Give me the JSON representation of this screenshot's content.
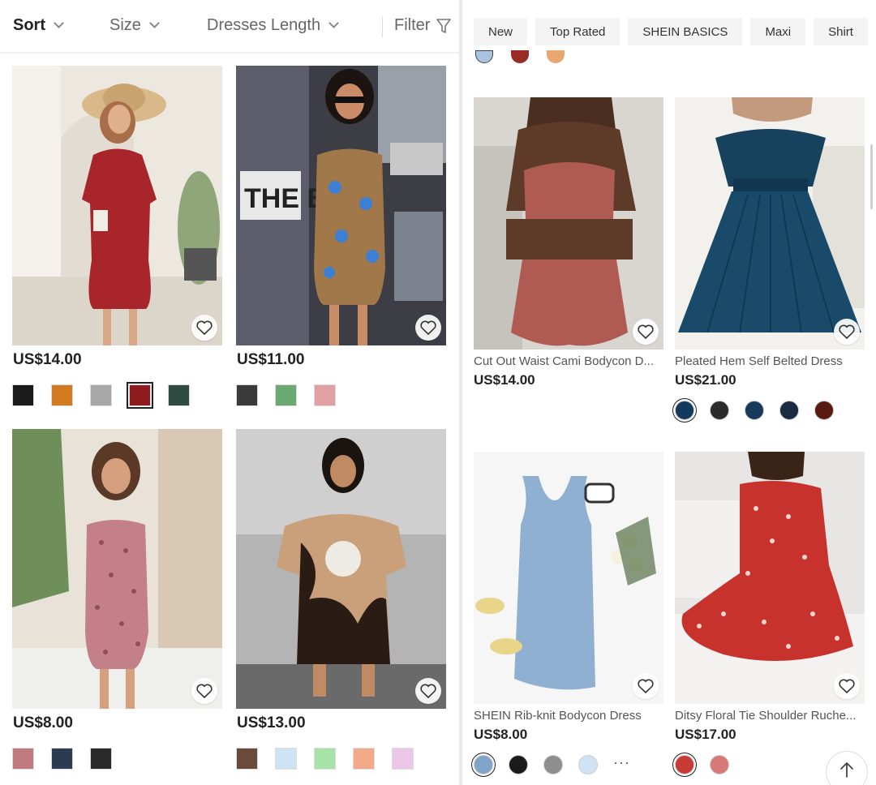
{
  "left": {
    "toolbar": {
      "sort": "Sort",
      "size": "Size",
      "length": "Dresses Length",
      "filter": "Filter"
    },
    "products": [
      {
        "price": "US$14.00",
        "swatches": [
          "#1a1a1a",
          "#d17a22",
          "#a8a8a8",
          "#8e1c1f",
          "#2f4a40"
        ],
        "selected": 3
      },
      {
        "price": "US$11.00",
        "swatches": [
          "#3a3a3a",
          "#6aaa72",
          "#e3a0a4"
        ],
        "selected": -1
      },
      {
        "price": "US$8.00",
        "swatches": [
          "#c07a80",
          "#2c3a52",
          "#2a2a2a"
        ],
        "selected": -1
      },
      {
        "price": "US$13.00",
        "swatches": [
          "#6a4a3a",
          "#cfe4f2",
          "#a6e3a8",
          "#f2a988",
          "#ebc6e6"
        ],
        "selected": -1
      }
    ]
  },
  "right": {
    "chips": [
      "New",
      "Top Rated",
      "SHEIN BASICS",
      "Maxi",
      "Shirt"
    ],
    "products": [
      {
        "title": "Cut Out Waist Cami Bodycon D...",
        "price": "US$14.00",
        "swatches": [],
        "selected": -1
      },
      {
        "title": "Pleated Hem Self Belted Dress",
        "price": "US$21.00",
        "swatches": [
          "#123a5c",
          "#2b2b2b",
          "#173a5a",
          "#1a2a40",
          "#5a1a14"
        ],
        "selected": 0
      },
      {
        "title": "SHEIN Rib-knit Bodycon Dress",
        "price": "US$8.00",
        "swatches": [
          "#7fa4c8",
          "#1a1a1a",
          "#8e8e8e",
          "#cfe3f5"
        ],
        "selected": 0,
        "more": "···"
      },
      {
        "title": "Ditsy Floral Tie Shoulder Ruche...",
        "price": "US$17.00",
        "swatches": [
          "#c83a34",
          "#d87878"
        ],
        "selected": 0
      }
    ]
  },
  "icons": {
    "favorite": "heart-icon",
    "back_to_top": "arrow-up-icon",
    "filter": "funnel-icon"
  }
}
